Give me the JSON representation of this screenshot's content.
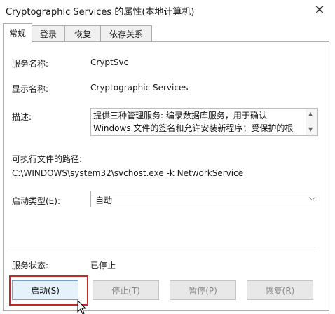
{
  "window": {
    "title": "Cryptographic Services 的属性(本地计算机)",
    "close_symbol": "✕"
  },
  "tabs": [
    {
      "label": "常规"
    },
    {
      "label": "登录"
    },
    {
      "label": "恢复"
    },
    {
      "label": "依存关系"
    }
  ],
  "general": {
    "service_name_label": "服务名称:",
    "service_name_value": "CryptSvc",
    "display_name_label": "显示名称:",
    "display_name_value": "Cryptographic Services",
    "description_label": "描述:",
    "description_value": "提供三种管理服务: 编录数据库服务，用于确认 Windows 文件的签名和允许安装新程序；受保护的根",
    "exe_path_label": "可执行文件的路径:",
    "exe_path_value": "C:\\WINDOWS\\system32\\svchost.exe -k NetworkService",
    "startup_type_label": "启动类型(E):",
    "startup_type_value": "自动",
    "service_status_label": "服务状态:",
    "service_status_value": "已停止"
  },
  "buttons": {
    "start": "启动(S)",
    "stop": "停止(T)",
    "pause": "暂停(P)",
    "resume": "恢复(R)"
  },
  "icons": {
    "scroll_up": "▲",
    "scroll_down": "▼",
    "chevron": "⌵"
  }
}
